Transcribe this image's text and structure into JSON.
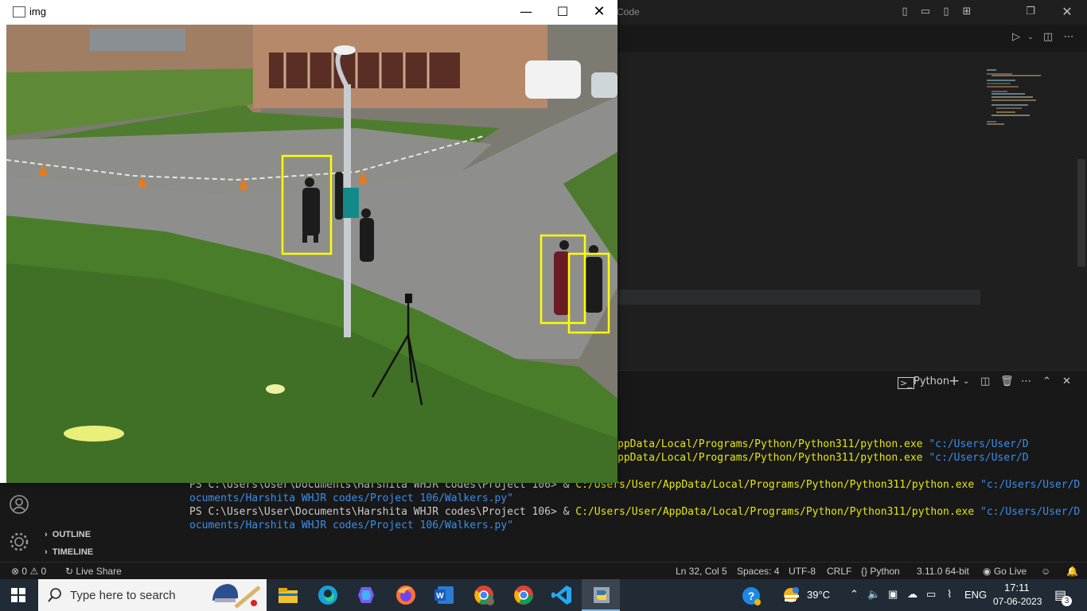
{
  "vscode": {
    "title_fragment": "Code",
    "terminal": {
      "tab_label": "Python",
      "lines": [
        {
          "a": "",
          "path": "ppData/Local/Programs/Python/Python311/python.exe",
          "str": " \"c:/Users/User/D"
        },
        {
          "a": "",
          "path": "ppData/Local/Programs/Python/Python311/python.exe",
          "str": " \"c:/Users/User/D"
        },
        {
          "cont": "ocuments/Harshita WHJR codes/Project 106/Walkers.py"
        },
        {
          "a": "PS C:\\Users\\User\\Documents\\Harshita WHJR codes\\Project 106> & ",
          "path": "C:/Users/User/AppData/Local/Programs/Python/Python311/python.exe",
          "str": " \"c:/Users/User/D"
        },
        {
          "cont": "ocuments/Harshita WHJR codes/Project 106/Walkers.py\""
        },
        {
          "a": "PS C:\\Users\\User\\Documents\\Harshita WHJR codes\\Project 106> & ",
          "path": "C:/Users/User/AppData/Local/Programs/Python/Python311/python.exe",
          "str": " \"c:/Users/User/D"
        },
        {
          "cont": "ocuments/Harshita WHJR codes/Project 106/Walkers.py\""
        }
      ]
    },
    "sidebar": {
      "outline": "OUTLINE",
      "timeline": "TIMELINE"
    },
    "status": {
      "errors": "0",
      "warnings": "0",
      "live_share": "Live Share",
      "position": "Ln 32, Col 5",
      "spaces": "Spaces: 4",
      "encoding": "UTF-8",
      "eol": "CRLF",
      "language": "Python",
      "interpreter": "3.11.0 64-bit",
      "go_live": "Go Live"
    }
  },
  "img_window": {
    "title": "img",
    "detections": 3
  },
  "taskbar": {
    "search_placeholder": "Type here to search",
    "weather": "39°C",
    "language": "ENG",
    "time": "17:11",
    "date": "07-06-2023",
    "notifications": "3",
    "apps": [
      "file-explorer-icon",
      "edge-icon",
      "copilot-icon",
      "firefox-icon",
      "word-icon",
      "chrome-profile-icon",
      "chrome-icon",
      "vscode-icon",
      "python-icon"
    ]
  }
}
